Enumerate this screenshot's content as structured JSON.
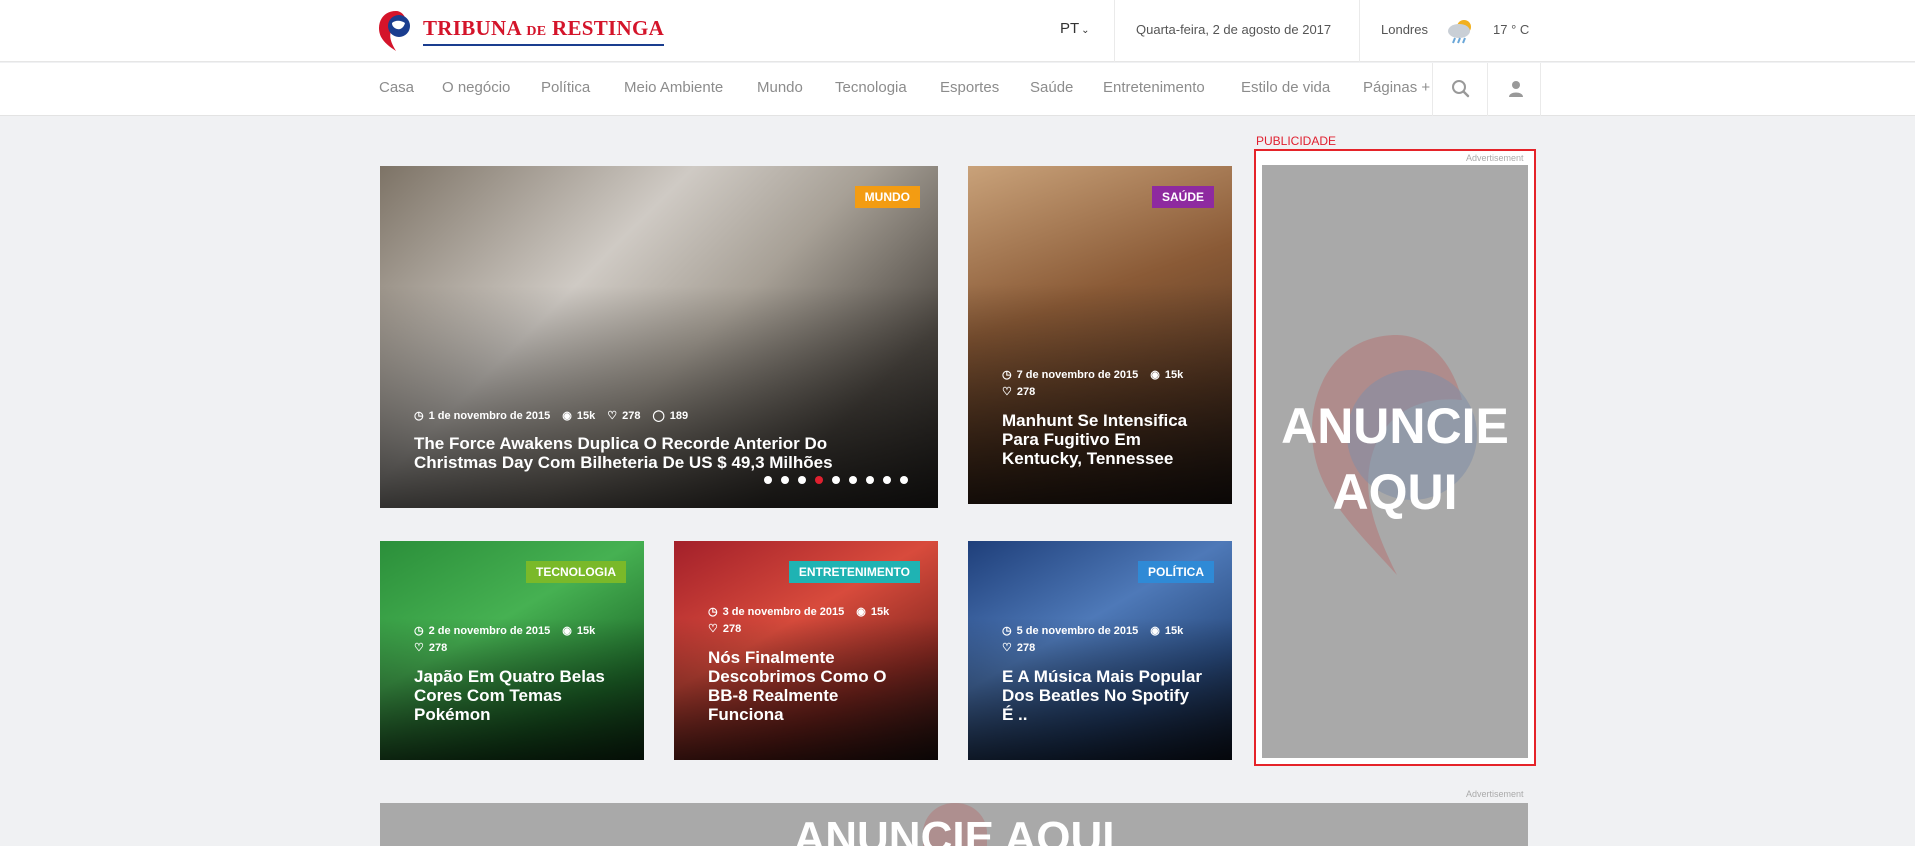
{
  "header": {
    "logo": {
      "word1": "TRIBUNA",
      "word2": "DE",
      "word3": "RESTINGA"
    },
    "language": "PT",
    "date": "Quarta-feira, 2 de agosto de 2017",
    "city": "Londres",
    "temperature": "17 ° C",
    "weather_icon": "cloud-rain-sun-icon"
  },
  "nav": {
    "items": [
      "Casa",
      "O negócio",
      "Política",
      "Meio Ambiente",
      "Mundo",
      "Tecnologia",
      "Esportes",
      "Saúde",
      "Entretenimento",
      "Estilo de vida",
      "Páginas +"
    ],
    "search_icon": "search-icon",
    "user_icon": "user-icon"
  },
  "featured": {
    "category": "MUNDO",
    "category_color": "#f39c12",
    "date": "1 de novembro de 2015",
    "views": "15k",
    "likes": "278",
    "comments": "189",
    "title": "The Force Awakens Duplica O Recorde Anterior Do Christmas Day Com Bilheteria De US $ 49,3 Milhões",
    "slider_count": 9,
    "slider_active": 4
  },
  "cards": [
    {
      "category": "SAÚDE",
      "category_color": "#8e2aa0",
      "date": "7 de novembro de 2015",
      "views": "15k",
      "likes": "278",
      "title": "Manhunt Se Intensifica Para Fugitivo Em Kentucky, Tennessee"
    },
    {
      "category": "TECNOLOGIA",
      "category_color": "#7ab929",
      "date": "2 de novembro de 2015",
      "views": "15k",
      "likes": "278",
      "title": "Japão Em Quatro Belas Cores Com Temas Pokémon"
    },
    {
      "category": "ENTRETENIMENTO",
      "category_color": "#1fb3b3",
      "date": "3 de novembro de 2015",
      "views": "15k",
      "likes": "278",
      "title": "Nós Finalmente Descobrimos Como O BB-8 Realmente Funciona"
    },
    {
      "category": "POLÍTICA",
      "category_color": "#2f8ad6",
      "date": "5 de novembro de 2015",
      "views": "15k",
      "likes": "278",
      "title": "E A Música Mais Popular Dos Beatles No Spotify É .."
    }
  ],
  "ads": {
    "publicidade_label": "PUBLICIDADE",
    "advertisement_label": "Advertisement",
    "ad_text_line1": "ANUNCIE",
    "ad_text_line2": "AQUI",
    "bottom_ad_text": "ANUNCIE AQUI"
  }
}
